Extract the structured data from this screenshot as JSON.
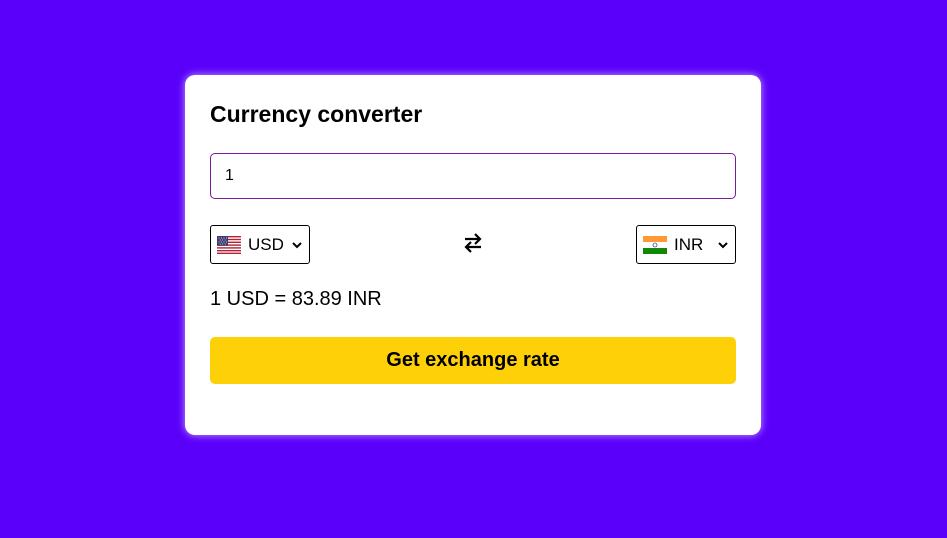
{
  "converter": {
    "title": "Currency converter",
    "amount_value": "1",
    "from": {
      "code": "USD",
      "flag_icon": "us-flag-icon"
    },
    "to": {
      "code": "INR",
      "flag_icon": "india-flag-icon"
    },
    "swap_icon": "swap-arrows-icon",
    "result_text": "1 USD = 83.89 INR",
    "button_label": "Get exchange rate"
  },
  "colors": {
    "background": "#5a00fa",
    "card": "#ffffff",
    "button": "#fdd008",
    "input_border": "#7a1a9a"
  }
}
